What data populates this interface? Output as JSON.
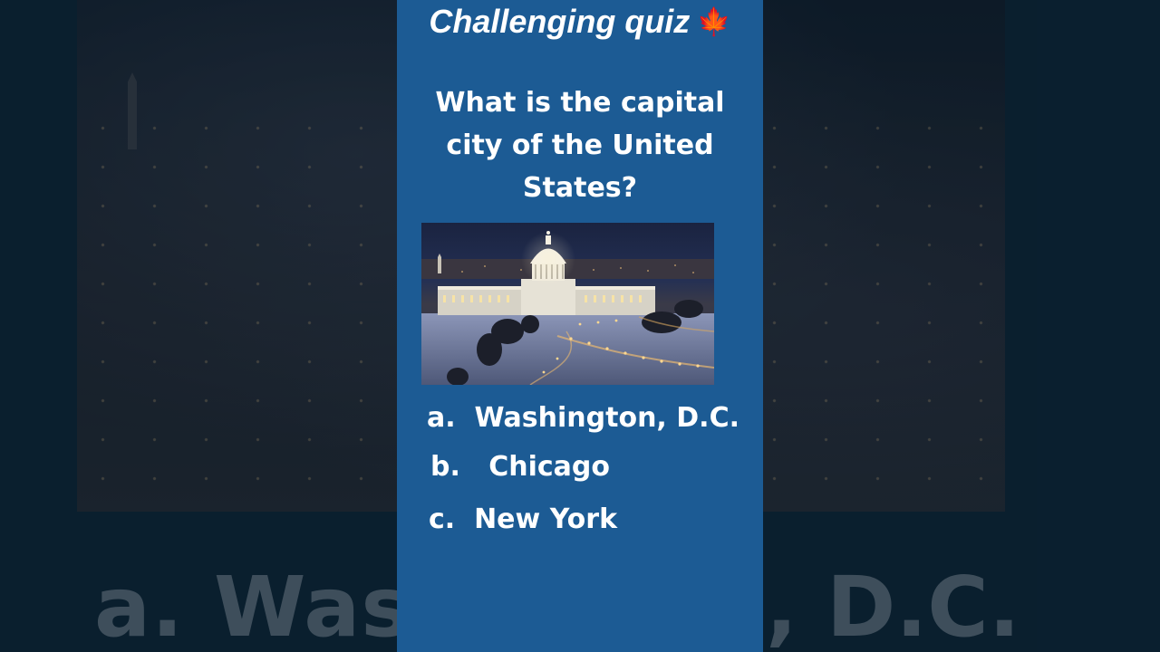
{
  "header": {
    "title": "Challenging quiz",
    "title_emoji": "🍁"
  },
  "question": {
    "text": "What is the capital city of the United States?"
  },
  "image": {
    "subject": "US Capitol at night in snow",
    "icon": "capitol-photo"
  },
  "answers": [
    {
      "letter": "a.",
      "text": "Washington, D.C."
    },
    {
      "letter": "b.",
      "text": "Chicago"
    },
    {
      "letter": "c.",
      "text": "New York"
    }
  ],
  "background_overlay": {
    "left_text": "a.  Was",
    "right_text": ", D.C."
  },
  "colors": {
    "panel": "#1c5b94",
    "text": "#ffffff",
    "accent_leaf": "#d9331a",
    "backdrop": "#0d2232"
  }
}
